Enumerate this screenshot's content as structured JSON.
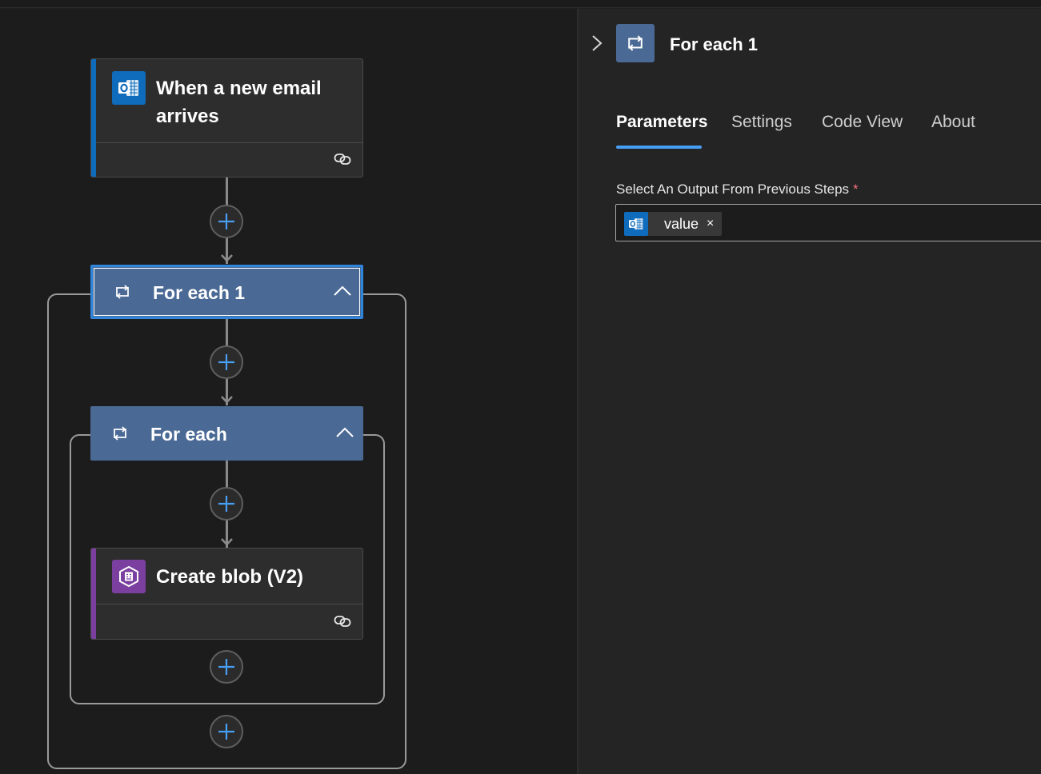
{
  "workflow": {
    "trigger": {
      "title_line1": "When a new email",
      "title_line2": "arrives",
      "connector_icon": "outlook-icon",
      "accent_color": "#0f6cbd"
    },
    "outer_loop": {
      "title": "For each 1",
      "icon": "loop-icon",
      "selected": true
    },
    "inner_loop": {
      "title": "For each",
      "icon": "loop-icon"
    },
    "action": {
      "title": "Create blob (V2)",
      "connector_icon": "azure-blob-storage-icon",
      "accent_color": "#7b3fa0"
    }
  },
  "panel": {
    "title": "For each 1",
    "tabs": [
      {
        "label": "Parameters",
        "active": true
      },
      {
        "label": "Settings",
        "active": false
      },
      {
        "label": "Code View",
        "active": false
      },
      {
        "label": "About",
        "active": false
      }
    ],
    "field": {
      "label": "Select An Output From Previous Steps",
      "required_mark": "*",
      "token": {
        "label": "value",
        "remove": "×",
        "icon": "outlook-icon"
      }
    }
  },
  "colors": {
    "loop_card": "#4a6a95",
    "selection": "#2f85db",
    "add_plus": "#479ef5",
    "tab_underline": "#479ef5"
  }
}
